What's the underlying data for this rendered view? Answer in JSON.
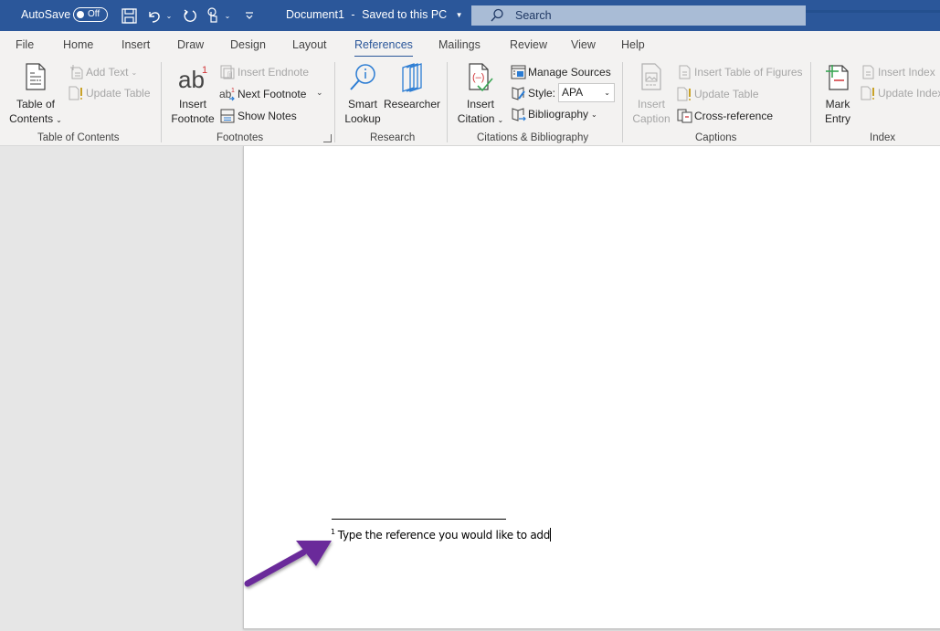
{
  "titlebar": {
    "autosave_label": "AutoSave",
    "autosave_state": "Off",
    "document_title": "Document1",
    "separator": "-",
    "save_status": "Saved to this PC",
    "search_placeholder": "Search",
    "icons": [
      "save-icon",
      "undo-icon",
      "redo-icon",
      "touch-mode-icon",
      "customize-toolbar-icon"
    ]
  },
  "tabs": [
    {
      "label": "File",
      "active": false
    },
    {
      "label": "Home",
      "active": false
    },
    {
      "label": "Insert",
      "active": false
    },
    {
      "label": "Draw",
      "active": false
    },
    {
      "label": "Design",
      "active": false
    },
    {
      "label": "Layout",
      "active": false
    },
    {
      "label": "References",
      "active": true
    },
    {
      "label": "Mailings",
      "active": false
    },
    {
      "label": "Review",
      "active": false
    },
    {
      "label": "View",
      "active": false
    },
    {
      "label": "Help",
      "active": false
    }
  ],
  "ribbon": {
    "toc": {
      "group_label": "Table of Contents",
      "toc_button_line1": "Table of",
      "toc_button_line2": "Contents",
      "add_text": "Add Text",
      "update_table": "Update Table"
    },
    "footnotes": {
      "group_label": "Footnotes",
      "insert_footnote_line1": "Insert",
      "insert_footnote_line2": "Footnote",
      "insert_endnote": "Insert Endnote",
      "next_footnote": "Next Footnote",
      "show_notes": "Show Notes"
    },
    "research": {
      "group_label": "Research",
      "smart_lookup_line1": "Smart",
      "smart_lookup_line2": "Lookup",
      "researcher": "Researcher"
    },
    "citations": {
      "group_label": "Citations & Bibliography",
      "insert_citation_line1": "Insert",
      "insert_citation_line2": "Citation",
      "manage_sources": "Manage Sources",
      "style_label": "Style:",
      "style_value": "APA",
      "bibliography": "Bibliography"
    },
    "captions": {
      "group_label": "Captions",
      "insert_caption_line1": "Insert",
      "insert_caption_line2": "Caption",
      "insert_table_of_figures": "Insert Table of Figures",
      "update_table": "Update Table",
      "cross_reference": "Cross-reference"
    },
    "index": {
      "group_label": "Index",
      "mark_entry_line1": "Mark",
      "mark_entry_line2": "Entry",
      "insert_index": "Insert Index",
      "update_index": "Update Index"
    }
  },
  "document": {
    "footnote_number": "1",
    "footnote_text": "Type the reference you would like to add"
  },
  "annotation": {
    "arrow_color": "#6a2a9a"
  },
  "colors": {
    "brand": "#2b579a",
    "search_bg": "#a9bcd6",
    "ribbon_bg": "#f3f2f1"
  }
}
